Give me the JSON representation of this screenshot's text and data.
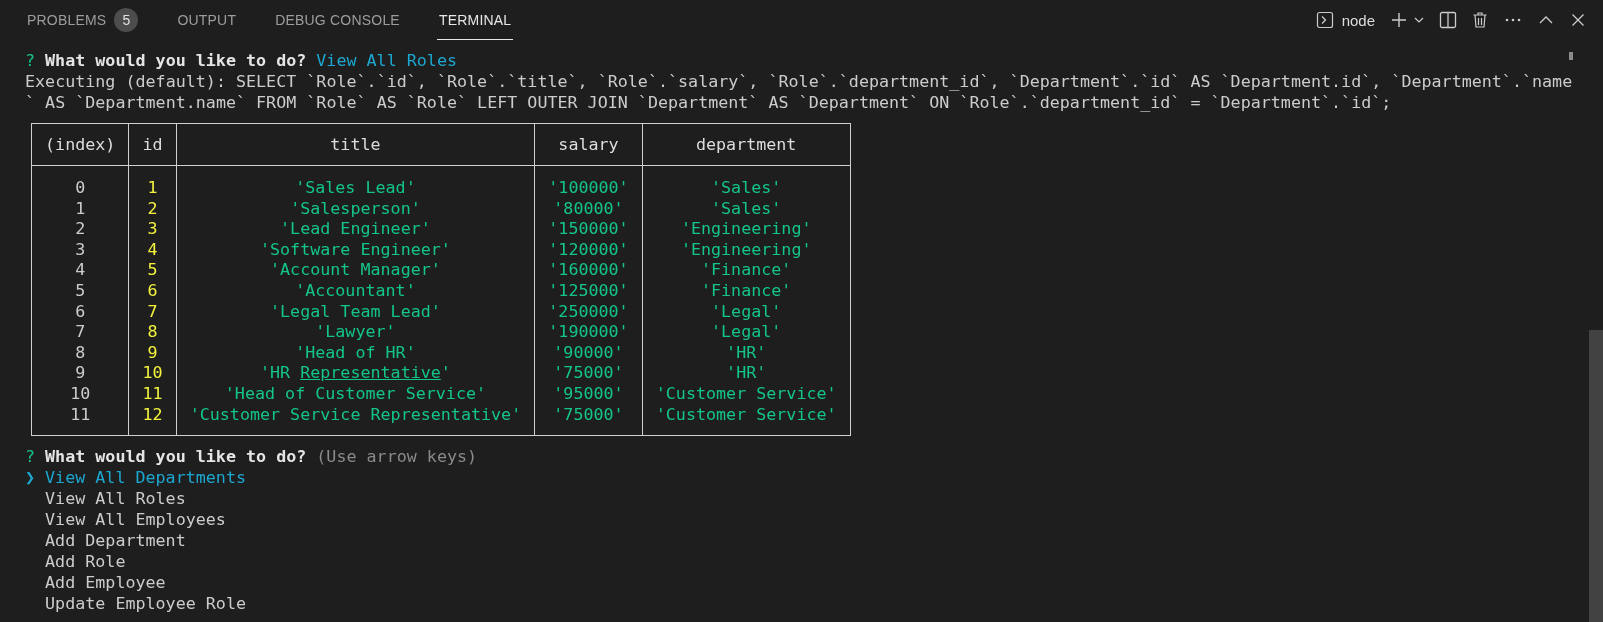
{
  "panel_tabs": [
    {
      "label": "PROBLEMS",
      "badge": "5",
      "selected": false
    },
    {
      "label": "OUTPUT",
      "selected": false
    },
    {
      "label": "DEBUG CONSOLE",
      "selected": false
    },
    {
      "label": "TERMINAL",
      "selected": true
    }
  ],
  "toolbar": {
    "terminal_name": "node"
  },
  "terminal": {
    "answered_prompt": {
      "mark": "?",
      "question": "What would you like to do?",
      "answer": "View All Roles"
    },
    "log_lines": [
      "Executing (default): SELECT `Role`.`id`, `Role`.`title`, `Role`.`salary`, `Role`.`department_id`, `Department`.`id` AS `Department.id`, `Department`.`name",
      "` AS `Department.name` FROM `Role` AS `Role` LEFT OUTER JOIN `Department` AS `Department` ON `Role`.`department_id` = `Department`.`id`;"
    ],
    "table": {
      "columns": [
        "(index)",
        "id",
        "title",
        "salary",
        "department"
      ],
      "rows": [
        {
          "index": "0",
          "id": "1",
          "title": "'Sales Lead'",
          "salary": "'100000'",
          "department": "'Sales'"
        },
        {
          "index": "1",
          "id": "2",
          "title": "'Salesperson'",
          "salary": "'80000'",
          "department": "'Sales'"
        },
        {
          "index": "2",
          "id": "3",
          "title": "'Lead Engineer'",
          "salary": "'150000'",
          "department": "'Engineering'"
        },
        {
          "index": "3",
          "id": "4",
          "title": "'Software Engineer'",
          "salary": "'120000'",
          "department": "'Engineering'"
        },
        {
          "index": "4",
          "id": "5",
          "title": "'Account Manager'",
          "salary": "'160000'",
          "department": "'Finance'"
        },
        {
          "index": "5",
          "id": "6",
          "title": "'Accountant'",
          "salary": "'125000'",
          "department": "'Finance'"
        },
        {
          "index": "6",
          "id": "7",
          "title": "'Legal Team Lead'",
          "salary": "'250000'",
          "department": "'Legal'"
        },
        {
          "index": "7",
          "id": "8",
          "title": "'Lawyer'",
          "salary": "'190000'",
          "department": "'Legal'"
        },
        {
          "index": "8",
          "id": "9",
          "title": "'Head of HR'",
          "salary": "'90000'",
          "department": "'HR'"
        },
        {
          "index": "9",
          "id": "10",
          "title": [
            {
              "text": "'HR ",
              "underlined": false
            },
            {
              "text": "Representative",
              "underlined": true
            },
            {
              "text": "'",
              "underlined": false
            }
          ],
          "salary": "'75000'",
          "department": "'HR'"
        },
        {
          "index": "10",
          "id": "11",
          "title": "'Head of Customer Service'",
          "salary": "'95000'",
          "department": "'Customer Service'"
        },
        {
          "index": "11",
          "id": "12",
          "title": "'Customer Service Representative'",
          "salary": "'75000'",
          "department": "'Customer Service'"
        }
      ]
    },
    "active_prompt": {
      "mark": "?",
      "question": "What would you like to do?",
      "hint": "(Use arrow keys)",
      "pointer": "❯",
      "choices": [
        {
          "label": "View All Departments",
          "selected": true
        },
        {
          "label": "View All Roles",
          "selected": false
        },
        {
          "label": "View All Employees",
          "selected": false
        },
        {
          "label": "Add Department",
          "selected": false
        },
        {
          "label": "Add Role",
          "selected": false
        },
        {
          "label": "Add Employee",
          "selected": false
        },
        {
          "label": "Update Employee Role",
          "selected": false
        }
      ]
    }
  }
}
